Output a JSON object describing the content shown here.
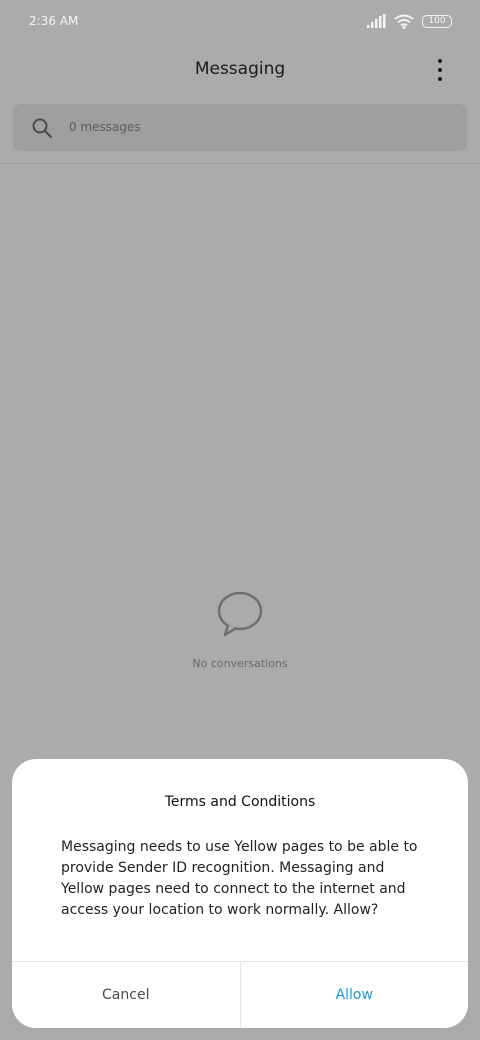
{
  "status_bar": {
    "time": "2:36 AM",
    "signal_icon": "cellular-signal-icon",
    "wifi_icon": "wifi-icon",
    "battery_level": "100"
  },
  "header": {
    "title": "Messaging",
    "more_icon": "more-vertical-icon"
  },
  "search": {
    "icon": "search-icon",
    "placeholder": "0 messages"
  },
  "empty_state": {
    "icon": "chat-bubble-icon",
    "label": "No conversations"
  },
  "dialog": {
    "title": "Terms and Conditions",
    "body": "Messaging needs to use Yellow pages to be able to provide Sender ID recognition. Messaging and Yellow pages need to connect to the internet and access your location to work normally. Allow?",
    "cancel_label": "Cancel",
    "allow_label": "Allow",
    "allow_color": "#1a9ad6"
  }
}
